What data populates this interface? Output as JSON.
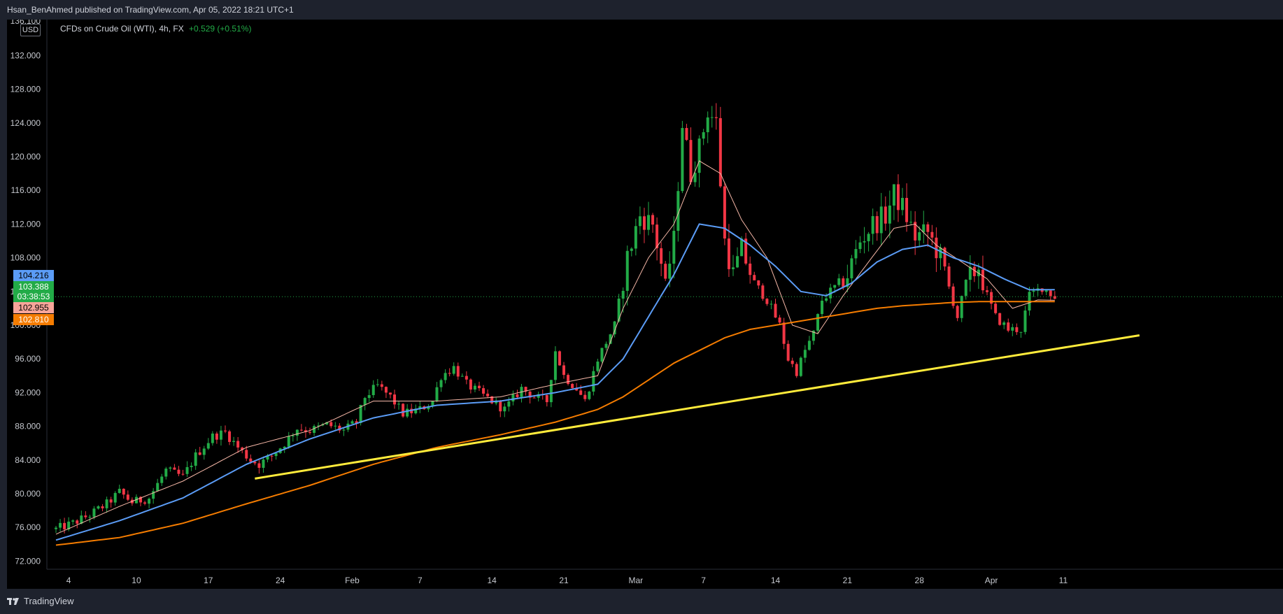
{
  "header": {
    "published_line": "Hsan_BenAhmed published on TradingView.com, Apr 05, 2022 18:21 UTC+1"
  },
  "legend": {
    "currency": "USD",
    "symbol_line": "CFDs on Crude Oil (WTI), 4h, FX",
    "change": "+0.529 (+0.51%)"
  },
  "footer": {
    "brand": "TradingView"
  },
  "price_tags": [
    {
      "label": "104.216",
      "color": "#5b9cf6",
      "text_color": "#000000"
    },
    {
      "label": "103.388",
      "color": "#22ab47",
      "text_color": "#ffffff"
    },
    {
      "label": "03:38:53",
      "color": "#22ab47",
      "text_color": "#ffffff"
    },
    {
      "label": "102.955",
      "color": "#f7a59a",
      "text_color": "#000000"
    },
    {
      "label": "102.810",
      "color": "#f57c00",
      "text_color": "#ffffff"
    }
  ],
  "colors": {
    "up": "#22ab47",
    "down": "#f23645",
    "ma_fast": "#f7b8a8",
    "ma_mid": "#5b9cf6",
    "ma_slow": "#f57c00",
    "trendline": "#ffeb3b",
    "current_line": "#22ab47"
  },
  "chart_data": {
    "type": "line",
    "title": "CFDs on Crude Oil (WTI), 4h, FX",
    "ylim": [
      68.8,
      136.1
    ],
    "y_ticks": [
      "136.100",
      "132.000",
      "128.000",
      "124.000",
      "120.000",
      "116.000",
      "112.000",
      "108.000",
      "104.000",
      "100.000",
      "96.000",
      "92.000",
      "88.000",
      "84.000",
      "80.000",
      "76.000",
      "72.000"
    ],
    "x_ticks": [
      "4",
      "10",
      "17",
      "24",
      "Feb",
      "7",
      "14",
      "21",
      "Mar",
      "7",
      "14",
      "21",
      "28",
      "Apr",
      "11"
    ],
    "current_price": 103.388,
    "price_path": [
      [
        0,
        75.8
      ],
      [
        4,
        76.5
      ],
      [
        8,
        77.5
      ],
      [
        12,
        78.8
      ],
      [
        15,
        80.2
      ],
      [
        18,
        79.0
      ],
      [
        22,
        79.5
      ],
      [
        26,
        82.8
      ],
      [
        30,
        82.0
      ],
      [
        33,
        84.5
      ],
      [
        37,
        86.8
      ],
      [
        40,
        87.3
      ],
      [
        43,
        85.5
      ],
      [
        46,
        84.0
      ],
      [
        48,
        83.5
      ],
      [
        51,
        84.5
      ],
      [
        54,
        86.0
      ],
      [
        57,
        87.8
      ],
      [
        60,
        87.5
      ],
      [
        64,
        88.2
      ],
      [
        68,
        87.5
      ],
      [
        71,
        88.5
      ],
      [
        73,
        91.5
      ],
      [
        76,
        92.8
      ],
      [
        79,
        91.5
      ],
      [
        82,
        89.5
      ],
      [
        86,
        90.0
      ],
      [
        89,
        91.0
      ],
      [
        91,
        94.0
      ],
      [
        94,
        95.0
      ],
      [
        97,
        93.0
      ],
      [
        100,
        92.0
      ],
      [
        103,
        91.0
      ],
      [
        106,
        90.0
      ],
      [
        110,
        92.5
      ],
      [
        113,
        91.5
      ],
      [
        116,
        91.0
      ],
      [
        118,
        97.0
      ],
      [
        120,
        94.0
      ],
      [
        123,
        92.5
      ],
      [
        125,
        91.0
      ],
      [
        128,
        96.0
      ],
      [
        132,
        100.0
      ],
      [
        135,
        108.0
      ],
      [
        138,
        113.0
      ],
      [
        141,
        112.0
      ],
      [
        144,
        105.0
      ],
      [
        146,
        110.0
      ],
      [
        148,
        124.0
      ],
      [
        150,
        118.0
      ],
      [
        152,
        121.0
      ],
      [
        154,
        125.5
      ],
      [
        156,
        124.0
      ],
      [
        158,
        110.0
      ],
      [
        160,
        106.0
      ],
      [
        162,
        109.0
      ],
      [
        165,
        105.0
      ],
      [
        168,
        103.0
      ],
      [
        171,
        100.0
      ],
      [
        173,
        96.0
      ],
      [
        175,
        94.5
      ],
      [
        177,
        97.0
      ],
      [
        179,
        99.0
      ],
      [
        181,
        103.0
      ],
      [
        184,
        104.5
      ],
      [
        187,
        106.0
      ],
      [
        190,
        110.0
      ],
      [
        193,
        112.0
      ],
      [
        196,
        113.0
      ],
      [
        198,
        115.5
      ],
      [
        200,
        114.0
      ],
      [
        203,
        110.5
      ],
      [
        206,
        111.0
      ],
      [
        209,
        108.0
      ],
      [
        211,
        104.5
      ],
      [
        213,
        101.0
      ],
      [
        215,
        105.0
      ],
      [
        218,
        107.0
      ],
      [
        220,
        103.5
      ],
      [
        222,
        101.0
      ],
      [
        225,
        99.5
      ],
      [
        228,
        99.5
      ],
      [
        230,
        103.5
      ],
      [
        233,
        104.5
      ],
      [
        236,
        103.388
      ]
    ],
    "series": [
      {
        "name": "",
        "color": "#f7b8a8",
        "points": [
          [
            0,
            75.2
          ],
          [
            15,
            78.5
          ],
          [
            30,
            81.5
          ],
          [
            45,
            85.5
          ],
          [
            60,
            87.5
          ],
          [
            75,
            91.0
          ],
          [
            90,
            91.0
          ],
          [
            105,
            91.5
          ],
          [
            118,
            93.0
          ],
          [
            128,
            94.0
          ],
          [
            134,
            102.0
          ],
          [
            140,
            108.0
          ],
          [
            146,
            112.0
          ],
          [
            152,
            119.5
          ],
          [
            157,
            118.0
          ],
          [
            162,
            112.5
          ],
          [
            168,
            108.0
          ],
          [
            174,
            100.0
          ],
          [
            180,
            99.0
          ],
          [
            186,
            103.5
          ],
          [
            192,
            107.5
          ],
          [
            198,
            111.5
          ],
          [
            203,
            112.0
          ],
          [
            208,
            109.5
          ],
          [
            214,
            107.5
          ],
          [
            220,
            105.5
          ],
          [
            226,
            102.0
          ],
          [
            232,
            103.0
          ],
          [
            236,
            102.955
          ]
        ]
      },
      {
        "name": "",
        "color": "#5b9cf6",
        "points": [
          [
            0,
            74.5
          ],
          [
            15,
            76.8
          ],
          [
            30,
            79.5
          ],
          [
            45,
            83.5
          ],
          [
            60,
            86.5
          ],
          [
            75,
            89.0
          ],
          [
            90,
            90.5
          ],
          [
            105,
            91.0
          ],
          [
            118,
            92.0
          ],
          [
            128,
            93.0
          ],
          [
            134,
            96.0
          ],
          [
            140,
            101.0
          ],
          [
            146,
            106.0
          ],
          [
            152,
            112.0
          ],
          [
            158,
            111.5
          ],
          [
            164,
            109.5
          ],
          [
            170,
            107.0
          ],
          [
            176,
            104.0
          ],
          [
            182,
            103.5
          ],
          [
            188,
            105.0
          ],
          [
            194,
            107.5
          ],
          [
            200,
            109.0
          ],
          [
            206,
            109.5
          ],
          [
            212,
            108.0
          ],
          [
            218,
            107.0
          ],
          [
            224,
            105.5
          ],
          [
            230,
            104.2
          ],
          [
            236,
            104.216
          ]
        ]
      },
      {
        "name": "",
        "color": "#f57c00",
        "points": [
          [
            0,
            73.9
          ],
          [
            15,
            74.8
          ],
          [
            30,
            76.5
          ],
          [
            45,
            78.8
          ],
          [
            60,
            81.0
          ],
          [
            75,
            83.5
          ],
          [
            90,
            85.5
          ],
          [
            105,
            87.0
          ],
          [
            118,
            88.5
          ],
          [
            128,
            90.0
          ],
          [
            134,
            91.5
          ],
          [
            140,
            93.5
          ],
          [
            146,
            95.5
          ],
          [
            152,
            97.0
          ],
          [
            158,
            98.5
          ],
          [
            164,
            99.5
          ],
          [
            170,
            100.0
          ],
          [
            176,
            100.5
          ],
          [
            182,
            101.0
          ],
          [
            188,
            101.5
          ],
          [
            194,
            102.0
          ],
          [
            200,
            102.3
          ],
          [
            206,
            102.5
          ],
          [
            212,
            102.7
          ],
          [
            218,
            102.8
          ],
          [
            224,
            102.8
          ],
          [
            230,
            102.8
          ],
          [
            236,
            102.81
          ]
        ]
      }
    ],
    "trendline": {
      "from": [
        47,
        81.8
      ],
      "to": [
        256,
        98.8
      ]
    }
  }
}
